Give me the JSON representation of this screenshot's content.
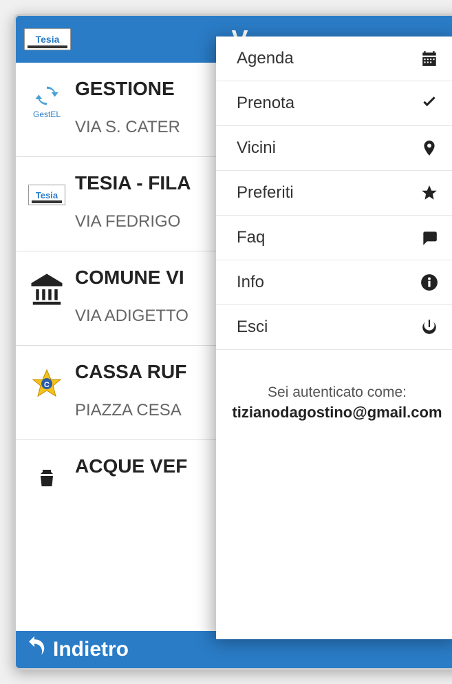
{
  "header": {
    "logo_text": "Tesia",
    "title": "V"
  },
  "list": [
    {
      "title": "GESTIONE",
      "subtitle": "VIA S. CATER",
      "icon": "gestel",
      "icon_label": "GestEL"
    },
    {
      "title": "TESIA - FILA",
      "subtitle": "VIA FEDRIGO",
      "icon": "tesia"
    },
    {
      "title": "COMUNE VI",
      "subtitle": "VIA ADIGETTO",
      "icon": "bank"
    },
    {
      "title": "CASSA RUF",
      "subtitle": "PIAZZA CESA",
      "icon": "cassa"
    },
    {
      "title": "ACQUE VEF",
      "subtitle": "",
      "icon": "acque"
    }
  ],
  "footer": {
    "back_label": "Indietro"
  },
  "menu": {
    "items": [
      {
        "label": "Agenda",
        "icon": "calendar"
      },
      {
        "label": "Prenota",
        "icon": "check"
      },
      {
        "label": "Vicini",
        "icon": "pin"
      },
      {
        "label": "Preferiti",
        "icon": "star"
      },
      {
        "label": "Faq",
        "icon": "chat"
      },
      {
        "label": "Info",
        "icon": "info"
      },
      {
        "label": "Esci",
        "icon": "power"
      }
    ],
    "auth_label": "Sei autenticato come:",
    "auth_email": "tizianodagostino@gmail.com"
  }
}
